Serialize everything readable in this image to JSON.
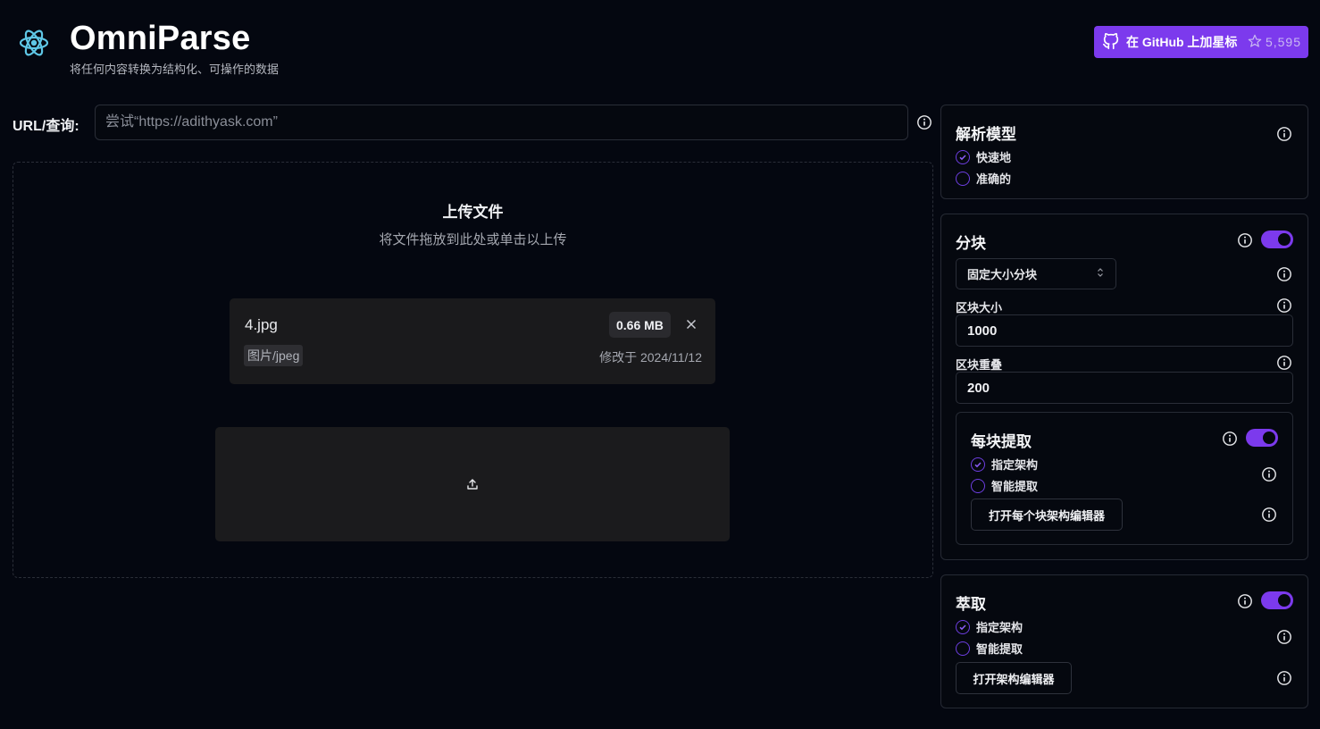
{
  "header": {
    "brand": "OmniParse",
    "tagline": "将任何内容转换为结构化、可操作的数据",
    "github_label": "在 GitHub 上加星标",
    "github_stars": "5,595"
  },
  "url_row": {
    "label": "URL/查询:",
    "placeholder": "尝试“https://adithyask.com”"
  },
  "upload": {
    "title": "上传文件",
    "hint": "将文件拖放到此处或单击以上传",
    "file": {
      "name": "4.jpg",
      "size": "0.66 MB",
      "type": "图片/jpeg",
      "modified": "修改于 2024/11/12"
    }
  },
  "parse_model": {
    "title": "解析模型",
    "options": [
      {
        "label": "快速地",
        "selected": true
      },
      {
        "label": "准确的",
        "selected": false
      }
    ]
  },
  "chunking": {
    "title": "分块",
    "enabled": true,
    "strategy": "固定大小分块",
    "chunk_size_label": "区块大小",
    "chunk_size": "1000",
    "chunk_overlap_label": "区块重叠",
    "chunk_overlap": "200",
    "per_chunk_extract": {
      "title": "每块提取",
      "enabled": true,
      "options": [
        {
          "label": "指定架构",
          "selected": true
        },
        {
          "label": "智能提取",
          "selected": false
        }
      ],
      "button": "打开每个块架构编辑器"
    }
  },
  "extraction": {
    "title": "萃取",
    "enabled": true,
    "options": [
      {
        "label": "指定架构",
        "selected": true
      },
      {
        "label": "智能提取",
        "selected": false
      }
    ],
    "button": "打开架构编辑器"
  },
  "colors": {
    "background": "#040710",
    "accent": "#7c3aed",
    "card": "#1a1a1c",
    "border": "#262a34"
  }
}
